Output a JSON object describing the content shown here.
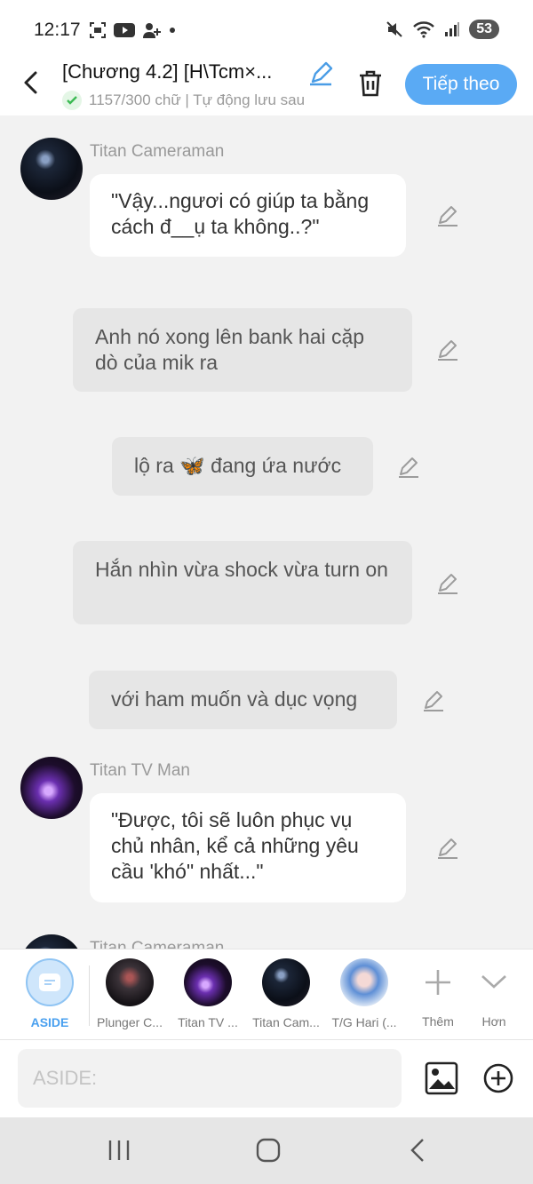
{
  "status_bar": {
    "time": "12:17",
    "battery": "53"
  },
  "header": {
    "title": "[Chương 4.2] [H\\Tcm×...",
    "subtitle": "1157/300 chữ | Tự động lưu sau",
    "next_label": "Tiếp theo",
    "accent_color": "#5aaaf4"
  },
  "messages": [
    {
      "type": "character",
      "speaker": "Titan Cameraman",
      "text": "\"Vậy...ngươi có giúp ta bằng cách đ__ụ ta không..?\""
    },
    {
      "type": "narration",
      "text": "Anh nó xong lên bank hai cặp dò của mik ra"
    },
    {
      "type": "narration",
      "text": "lộ ra 🦋 đang ứa nước"
    },
    {
      "type": "narration",
      "text": "Hắn nhìn vừa shock vừa turn on"
    },
    {
      "type": "narration",
      "text": "với ham muốn và dục vọng"
    },
    {
      "type": "character",
      "speaker": "Titan TV Man",
      "text": "\"Được, tôi sẽ luôn phục vụ chủ nhân, kể cả những yêu cầu 'khó\" nhất...\""
    },
    {
      "type": "character",
      "speaker": "Titan Cameraman",
      "text": ""
    }
  ],
  "characters": {
    "aside": "ASIDE",
    "list": [
      "Plunger C...",
      "Titan TV ...",
      "Titan Cam...",
      "T/G Hari (..."
    ],
    "more": "Thêm",
    "less": "Hơn"
  },
  "input": {
    "placeholder": "ASIDE:"
  }
}
